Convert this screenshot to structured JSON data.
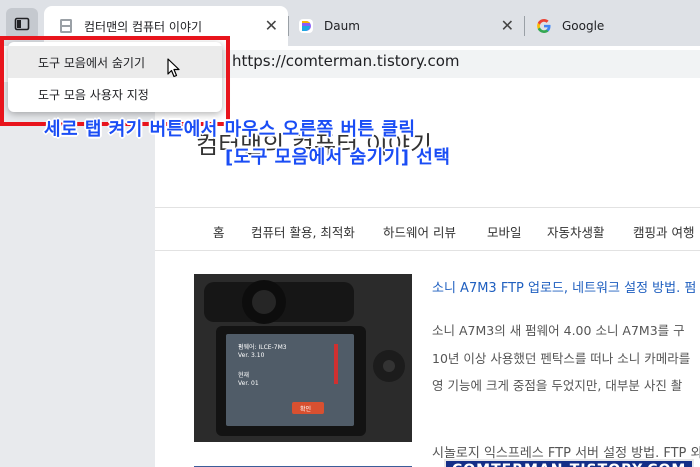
{
  "tabs": [
    {
      "title": "컴터맨의 컴퓨터 이야기",
      "active": true,
      "icon": "document-icon"
    },
    {
      "title": "Daum",
      "active": false,
      "icon": "daum-logo-icon"
    },
    {
      "title": "Google",
      "active": false,
      "icon": "google-logo-icon"
    }
  ],
  "toolbar": {
    "url": "https://comterman.tistory.com"
  },
  "context_menu": {
    "items": [
      {
        "label": "도구 모음에서 숨기기",
        "hovered": true
      },
      {
        "label": "도구 모음 사용자 지정",
        "hovered": false
      }
    ]
  },
  "caption": {
    "line1": "세로 탭 켜기 버튼에서 마우스 오른쪽 버튼 클릭",
    "line2": "[도구 모음에서 숨기기] 선택",
    "color": "#1a4df5"
  },
  "page": {
    "blog_title": "컴터맨의 컴퓨터 이야기",
    "nav": [
      "홈",
      "컴퓨터 활용, 최적화",
      "하드웨어 리뷰",
      "모바일",
      "자동차생활",
      "캠핑과 여행"
    ],
    "posts": [
      {
        "title": "소니 A7M3 FTP 업로드, 네트워크 설정 방법. 펌",
        "excerpt": [
          "소니 A7M3의 새 펌웨어 4.00 소니 A7M3를 구",
          "10년 이상 사용했던 펜탁스를 떠나 소니 카메라를",
          "영 기능에 크게 중점을 두었지만, 대부분 사진 촬"
        ],
        "thumbnail_text": [
          "펌웨어: ILCE-7M3",
          "Ver. 3.10",
          "현재",
          "Ver. 01",
          "확인"
        ]
      },
      {
        "title": "시놀로지 익스프레스 FTP 서버 설정 방법. FTP 외"
      }
    ]
  },
  "watermark": "COMTERMAN.TISTORY.COM",
  "colors": {
    "highlight": "#e8141c",
    "tabbar": "#dee1e6",
    "link": "#2060c0",
    "watermark_bg": "#142f88"
  }
}
